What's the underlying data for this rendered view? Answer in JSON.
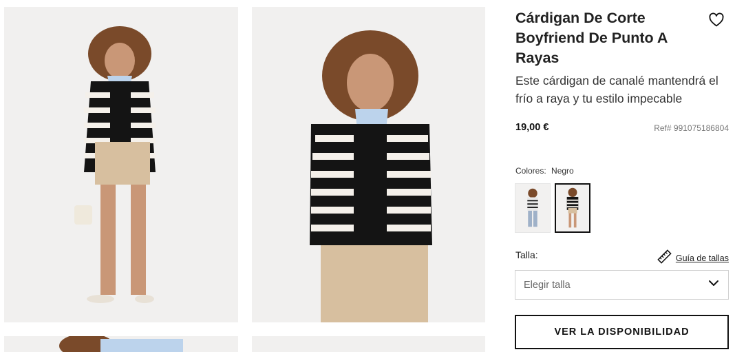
{
  "product": {
    "title": "Cárdigan De Corte Boyfriend De Punto A Rayas",
    "description": "Este cárdigan de canalé mantendrá el frío a raya y tu estilo impecable",
    "price": "19,00 €",
    "ref": "Ref# 991075186804"
  },
  "colors": {
    "label": "Colores:",
    "selected": "Negro",
    "accent_dark": "#111111",
    "accent_light": "#ffffff"
  },
  "size": {
    "label": "Talla:",
    "guide_label": "Guía de tallas",
    "placeholder": "Elegir talla"
  },
  "cta": {
    "label": "VER LA DISPONIBILIDAD"
  },
  "icons": {
    "favorite": "heart-icon",
    "guide": "ruler-icon",
    "dropdown": "chevron-down-icon"
  }
}
